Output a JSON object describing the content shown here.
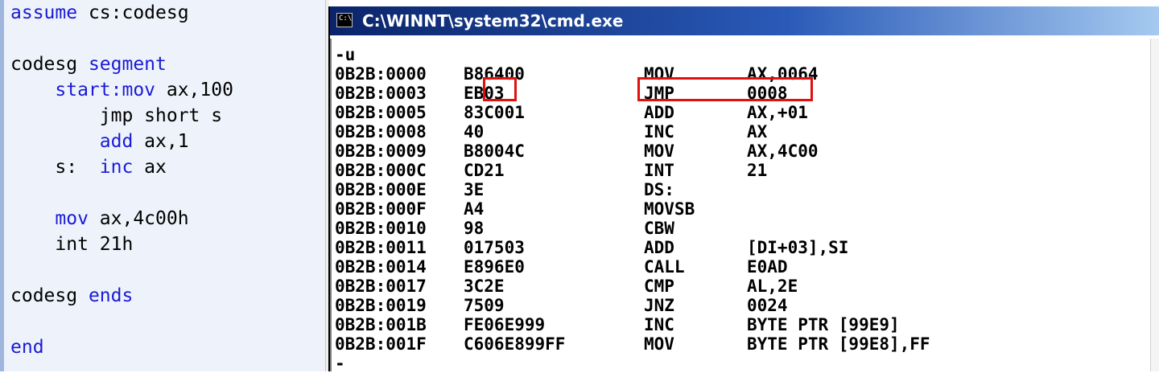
{
  "editor": {
    "lines": [
      {
        "indent": "",
        "label": "",
        "keyword": "assume",
        "rest": " cs:codesg"
      },
      {
        "indent": "",
        "label": "",
        "keyword": "",
        "rest": ""
      },
      {
        "indent": "",
        "label": "codesg ",
        "keyword": "segment",
        "rest": ""
      },
      {
        "indent": "    ",
        "label": "",
        "keyword": "start:mov",
        "rest": " ax,100"
      },
      {
        "indent": "        ",
        "label": "",
        "keyword": "",
        "rest": "jmp short s"
      },
      {
        "indent": "        ",
        "label": "",
        "keyword": "add",
        "rest": " ax,1"
      },
      {
        "indent": "    ",
        "label": "s:  ",
        "keyword": "inc",
        "rest": " ax"
      },
      {
        "indent": "",
        "label": "",
        "keyword": "",
        "rest": ""
      },
      {
        "indent": "    ",
        "label": "",
        "keyword": "mov",
        "rest": " ax,4c00h"
      },
      {
        "indent": "    ",
        "label": "",
        "keyword": "",
        "rest": "int 21h"
      },
      {
        "indent": "",
        "label": "",
        "keyword": "",
        "rest": ""
      },
      {
        "indent": "",
        "label": "codesg ",
        "keyword": "ends",
        "rest": ""
      },
      {
        "indent": "",
        "label": "",
        "keyword": "",
        "rest": ""
      },
      {
        "indent": "",
        "label": "",
        "keyword": "end",
        "rest": ""
      }
    ]
  },
  "console": {
    "title": "C:\\WINNT\\system32\\cmd.exe",
    "icon_label": "C:\\",
    "command": "-u",
    "prompt": "-",
    "rows": [
      {
        "addr": "0B2B:0000",
        "hex": "B86400",
        "mnemonic": "MOV",
        "operand": "AX,0064"
      },
      {
        "addr": "0B2B:0003",
        "hex": "EB03",
        "mnemonic": "JMP",
        "operand": "0008"
      },
      {
        "addr": "0B2B:0005",
        "hex": "83C001",
        "mnemonic": "ADD",
        "operand": "AX,+01"
      },
      {
        "addr": "0B2B:0008",
        "hex": "40",
        "mnemonic": "INC",
        "operand": "AX"
      },
      {
        "addr": "0B2B:0009",
        "hex": "B8004C",
        "mnemonic": "MOV",
        "operand": "AX,4C00"
      },
      {
        "addr": "0B2B:000C",
        "hex": "CD21",
        "mnemonic": "INT",
        "operand": "21"
      },
      {
        "addr": "0B2B:000E",
        "hex": "3E",
        "mnemonic": "DS:",
        "operand": ""
      },
      {
        "addr": "0B2B:000F",
        "hex": "A4",
        "mnemonic": "MOVSB",
        "operand": ""
      },
      {
        "addr": "0B2B:0010",
        "hex": "98",
        "mnemonic": "CBW",
        "operand": ""
      },
      {
        "addr": "0B2B:0011",
        "hex": "017503",
        "mnemonic": "ADD",
        "operand": "[DI+03],SI"
      },
      {
        "addr": "0B2B:0014",
        "hex": "E896E0",
        "mnemonic": "CALL",
        "operand": "E0AD"
      },
      {
        "addr": "0B2B:0017",
        "hex": "3C2E",
        "mnemonic": "CMP",
        "operand": "AL,2E"
      },
      {
        "addr": "0B2B:0019",
        "hex": "7509",
        "mnemonic": "JNZ",
        "operand": "0024"
      },
      {
        "addr": "0B2B:001B",
        "hex": "FE06E999",
        "mnemonic": "INC",
        "operand": "BYTE PTR [99E9]"
      },
      {
        "addr": "0B2B:001F",
        "hex": "C606E899FF",
        "mnemonic": "MOV",
        "operand": "BYTE PTR [99E8],FF"
      }
    ]
  },
  "colors": {
    "keyword": "#1a1ad4",
    "highlight": "#e01010",
    "titlebar_start": "#0a246a",
    "titlebar_end": "#a6caf0"
  }
}
